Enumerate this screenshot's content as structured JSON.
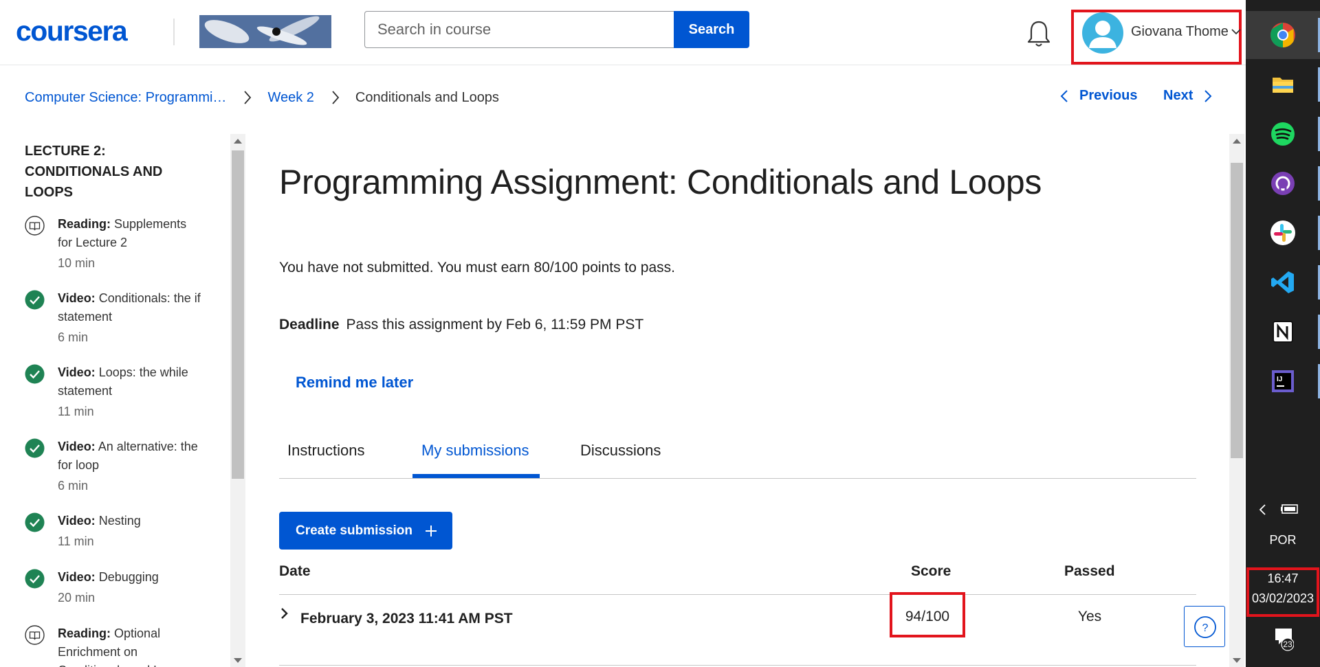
{
  "header": {
    "logo": "coursera",
    "search_placeholder": "Search in course",
    "search_button": "Search",
    "user_name": "Giovana Thome"
  },
  "breadcrumb": {
    "course": "Computer Science: Programmi…",
    "week": "Week 2",
    "current": "Conditionals and Loops"
  },
  "nav": {
    "previous": "Previous",
    "next": "Next"
  },
  "sidebar": {
    "title": "LECTURE 2: CONDITIONALS AND LOOPS",
    "items": [
      {
        "type": "Reading:",
        "title": "Supplements for Lecture 2",
        "duration": "10 min",
        "icon": "reading-icon"
      },
      {
        "type": "Video:",
        "title": "Conditionals: the if statement",
        "duration": "6 min",
        "icon": "check-icon"
      },
      {
        "type": "Video:",
        "title": "Loops: the while statement",
        "duration": "11 min",
        "icon": "check-icon"
      },
      {
        "type": "Video:",
        "title": "An alternative: the for loop",
        "duration": "6 min",
        "icon": "check-icon"
      },
      {
        "type": "Video:",
        "title": "Nesting",
        "duration": "11 min",
        "icon": "check-icon"
      },
      {
        "type": "Video:",
        "title": "Debugging",
        "duration": "20 min",
        "icon": "check-icon"
      },
      {
        "type": "Reading:",
        "title": "Optional Enrichment on Conditionals and Loops",
        "duration": "",
        "icon": "reading-icon"
      }
    ]
  },
  "main": {
    "title": "Programming Assignment: Conditionals and Loops",
    "status": "You have not submitted. You must earn 80/100 points to pass.",
    "deadline_label": "Deadline",
    "deadline_text": "Pass this assignment by Feb 6, 11:59 PM PST",
    "remind": "Remind me later",
    "tabs": [
      "Instructions",
      "My submissions",
      "Discussions"
    ],
    "active_tab": "My submissions",
    "create_button": "Create submission",
    "table": {
      "headers": {
        "date": "Date",
        "score": "Score",
        "passed": "Passed"
      },
      "rows": [
        {
          "date": "February 3, 2023 11:41 AM PST",
          "score": "94/100",
          "passed": "Yes"
        }
      ]
    },
    "help": "?"
  },
  "taskbar": {
    "apps": [
      "chrome-icon",
      "file-explorer-icon",
      "spotify-icon",
      "github-desktop-icon",
      "slack-icon",
      "vscode-icon",
      "notion-icon",
      "intellij-icon"
    ],
    "language": "POR",
    "time": "16:47",
    "date": "03/02/2023",
    "notifications": "23"
  },
  "colors": {
    "brand": "#0056d2",
    "highlight": "#e2141c",
    "success": "#1f8354",
    "taskbar": "#1f1f1f"
  }
}
